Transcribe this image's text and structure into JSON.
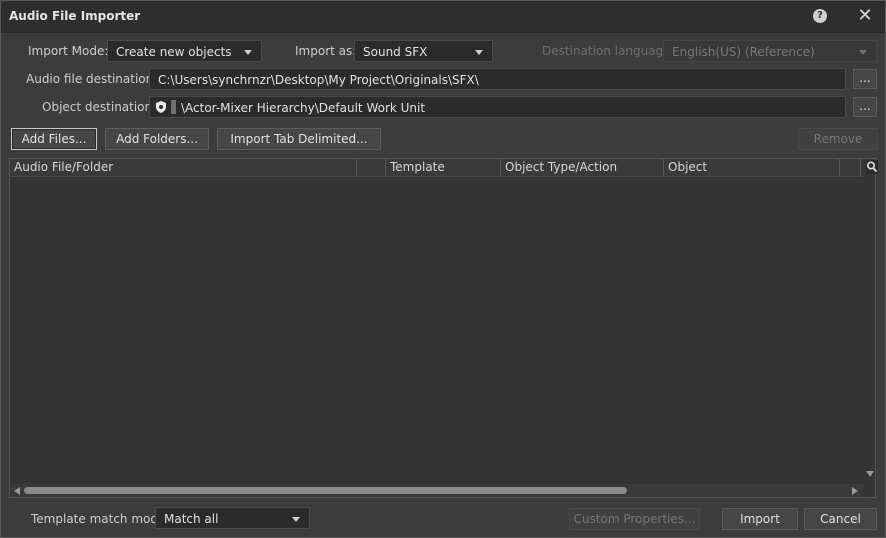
{
  "window": {
    "title": "Audio File Importer"
  },
  "titlebar": {
    "help_glyph": "?",
    "close_glyph": "✕"
  },
  "import_mode": {
    "label": "Import Mode:",
    "value": "Create new objects"
  },
  "import_as": {
    "label": "Import as:",
    "value": "Sound SFX"
  },
  "destination_language": {
    "label": "Destination language:",
    "value": "English(US) (Reference)"
  },
  "audio_dest": {
    "label": "Audio file destination",
    "value": "C:\\Users\\synchrnzr\\Desktop\\My Project\\Originals\\SFX\\",
    "browse_label": "..."
  },
  "object_dest": {
    "label": "Object destination",
    "value": "\\Actor-Mixer Hierarchy\\Default Work Unit",
    "browse_label": "..."
  },
  "toolbar": {
    "add_files": "Add Files...",
    "add_folders": "Add Folders...",
    "import_tab_delimited": "Import Tab Delimited...",
    "remove": "Remove"
  },
  "table": {
    "columns": [
      "Audio File/Folder",
      "",
      "Template",
      "Object Type/Action",
      "Object",
      ""
    ],
    "rows": []
  },
  "footer": {
    "template_match_label": "Template match mode:",
    "template_match_value": "Match all",
    "custom_properties": "Custom Properties...",
    "import": "Import",
    "cancel": "Cancel"
  },
  "icons": [
    "help-icon",
    "close-icon",
    "work-unit-icon",
    "search-icon",
    "chevron-down-icon"
  ]
}
